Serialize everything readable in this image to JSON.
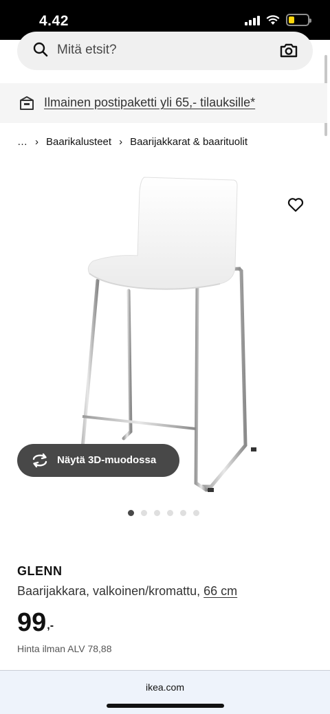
{
  "status_bar": {
    "time": "4.42",
    "battery_level": 0.3,
    "battery_color": "#ffd60a"
  },
  "search": {
    "placeholder": "Mitä etsit?",
    "icons": [
      "search-icon",
      "camera-icon"
    ]
  },
  "promo": {
    "text": "Ilmainen postipaketti yli 65,- tilauksille*",
    "icon": "box-icon"
  },
  "breadcrumb": {
    "items": [
      "…",
      "Baarikalusteet",
      "Baarijakkarat & baarituolit"
    ]
  },
  "gallery": {
    "view_3d_label": "Näytä 3D-muodossa",
    "image_count": 6,
    "active_index": 0
  },
  "product": {
    "name": "GLENN",
    "description": "Baarijakkara, valkoinen/kromattu,",
    "size": "66 cm",
    "price": "99",
    "price_suffix": ",-",
    "vat_text": "Hinta ilman ALV 78,88"
  },
  "browser": {
    "url": "ikea.com"
  },
  "colors": {
    "accent_dark": "#484848",
    "promo_bg": "#f5f5f5",
    "search_bg": "#f0f0f0"
  }
}
